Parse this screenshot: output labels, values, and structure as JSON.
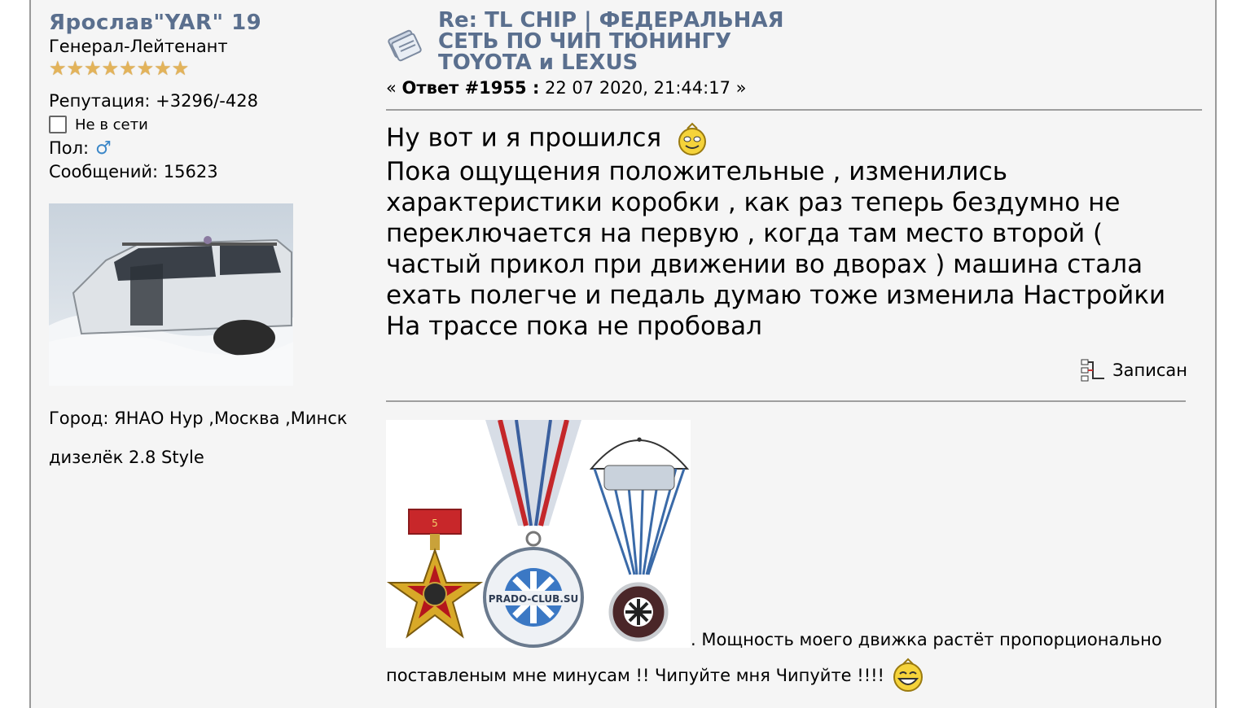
{
  "poster": {
    "username": "Ярослав\"YAR\" 19",
    "rank": "Генерал-Лейтенант",
    "star_count": 8,
    "reputation": "Репутация: +3296/-428",
    "status": "Не в сети",
    "gender_label": "Пол:",
    "gender_icon": "male-icon",
    "messages": "Сообщений: 15623",
    "city": "Город: ЯНАО Нур ,Москва ,Минск",
    "car": "дизелёк 2.8 Style"
  },
  "post": {
    "title": "Re: TL CHIP | ФЕДЕРАЛЬНАЯ СЕТЬ ПО ЧИП ТЮНИНГУ TOYOTA и LEXUS",
    "reply_prefix": "«",
    "reply_label": "Ответ #1955 :",
    "reply_date": "22 07 2020, 21:44:17",
    "reply_suffix": "»",
    "body_line1": "Ну вот и я прошился",
    "body_paragraph": "Пока ощущения положительные , изменились характеристики коробки , как раз теперь бездумно не переключается на первую , когда там место второй ( частый прикол при движении во дворах ) машина стала ехать полегче и педаль думаю тоже изменила Настройки На трассе пока не пробовал",
    "recorded_label": "Записан"
  },
  "signature": {
    "line1": ". Мощность моего движка растёт пропорционально",
    "line2": "поставленым мне минусам !! Чипуйте мня Чипуйте !!!!",
    "medal_texts": [
      "PRADO-CLUB.SU"
    ]
  },
  "colors": {
    "link": "#5a6f8e",
    "background": "#f5f5f5",
    "star": "#e3b35a"
  }
}
